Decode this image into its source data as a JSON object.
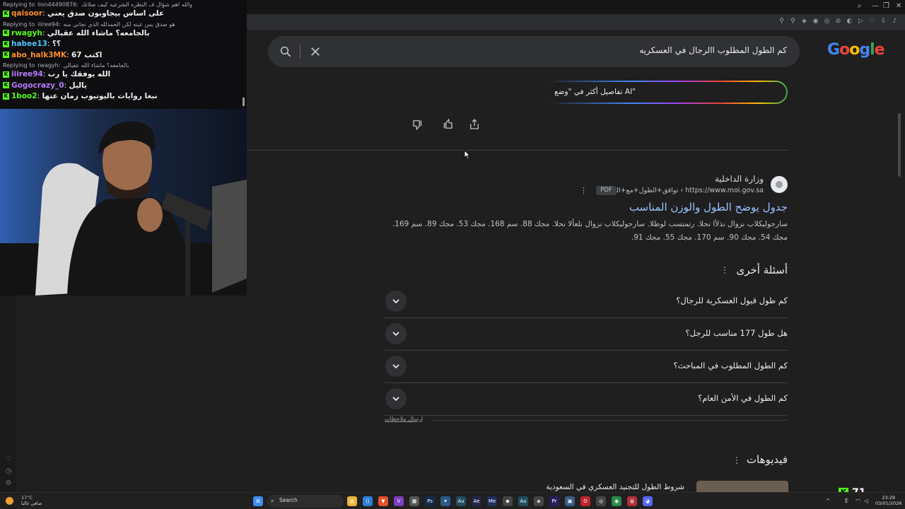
{
  "chat": {
    "messages": [
      {
        "kind": "reply",
        "text": "Replying to",
        "replied_user": "lion44490876:",
        "replied_text": "والله اهم شؤال ف النظره الشرعيه كيف صلاتك"
      },
      {
        "kind": "msg",
        "user": "qaisoor",
        "user_color": "#ff8c2b",
        "text": "على اساس بيجاوبون صدق يعني"
      },
      {
        "kind": "reply",
        "text": "Replying to",
        "replied_user": "iiiree94:",
        "replied_text": "هو صدق بس عينه لكن الحمدلله الذي نجاني منه"
      },
      {
        "kind": "msg",
        "user": "rwagyh",
        "user_color": "#53fc18",
        "text": "بالجامعه؟ ماشاء الله عقبالي"
      },
      {
        "kind": "msg",
        "user": "habee13",
        "user_color": "#4fc3f7",
        "text": "؟؟"
      },
      {
        "kind": "msg",
        "user": "abo_halk3MK",
        "user_color": "#ff8c2b",
        "text": "اكتب 67"
      },
      {
        "kind": "reply",
        "text": "Replying to",
        "replied_user": "rwagyh:",
        "replied_text": "بالجامعه؟ ماشاء الله عقبالي"
      },
      {
        "kind": "msg",
        "user": "iiiree94",
        "user_color": "#b57bff",
        "text": "الله يوفقك يا رب"
      },
      {
        "kind": "msg",
        "user": "Gogocrazy_0",
        "user_color": "#b57bff",
        "text": "ياليل"
      },
      {
        "kind": "msg",
        "user": "1boo2",
        "user_color": "#53fc18",
        "text": "نبغا روايات باليوتيوب زمان عتها"
      }
    ]
  },
  "search": {
    "query": "كم الطول المطلوب االرجال في العسكريه",
    "logo": "Google"
  },
  "ai_mode": {
    "label": "تفاصيل أكثر في \"وضع AI\""
  },
  "result": {
    "site_name": "وزارة الداخلية",
    "url": "https://www.moi.gov.sa › تواقق+الطول+مع+الوزن",
    "pdf_badge": "PDF",
    "title": "جدول يوضح الطول والوزن المناسب",
    "snippet": "سارجوليكلاب نزوال نذلأا نحلا. رتمتسب لوطلا. سارجوليكلاب نزوال نلعألا نحلا. مجك 88. سم 168. مجك 53. مجك 89. سم 169. مجك 54. مجك 90. سم 170. مجك 55. مجك 91."
  },
  "paa": {
    "header": "أسئلة أخرى",
    "items": [
      "كم طول قبول العسكرية للرجال؟",
      "هل طول 177 مناسب للرجل؟",
      "كم الطول المطلوب في المباحث؟",
      "كم الطول في الأمن العام؟"
    ],
    "feedback": "إرسال ملاحظات"
  },
  "videos": {
    "header": "فيديوهات",
    "first_title": "شروط الطول للتجنيد العسكري في السعودية"
  },
  "stream": {
    "viewer_count": "71"
  },
  "taskbar": {
    "search_placeholder": "Search",
    "weather_temp": "17°C",
    "weather_desc": "صافي غالبا",
    "time": "23:29",
    "date": "03/01/2026"
  }
}
